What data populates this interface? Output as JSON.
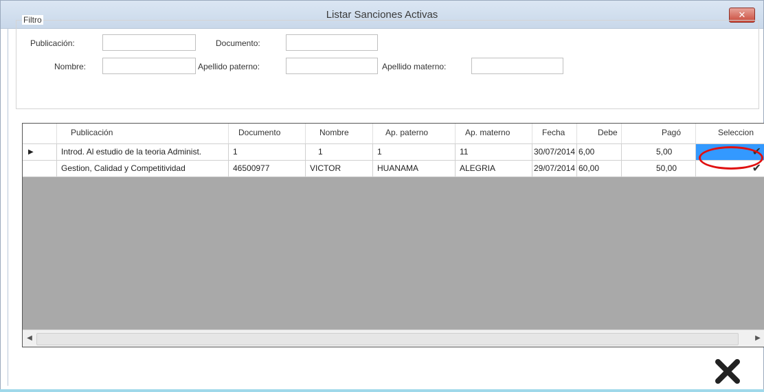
{
  "window": {
    "title": "Listar Sanciones Activas",
    "close_label": "✕"
  },
  "filter": {
    "legend": "Filtro",
    "publicacion_label": "Publicación:",
    "documento_label": "Documento:",
    "nombre_label": "Nombre:",
    "apellido_paterno_label": "Apellido paterno:",
    "apellido_materno_label": "Apellido materno:",
    "publicacion_value": "",
    "documento_value": "",
    "nombre_value": "",
    "apellido_paterno_value": "",
    "apellido_materno_value": ""
  },
  "grid": {
    "columns": [
      "Publicación",
      "Documento",
      "Nombre",
      "Ap. paterno",
      "Ap. materno",
      "Fecha",
      "Debe",
      "Pagó",
      "Seleccion"
    ],
    "rows": [
      {
        "marker": "▶",
        "publicacion": "Introd. Al estudio de la teoria Administ.",
        "documento": "1",
        "nombre": "1",
        "ap_paterno": "1",
        "ap_materno": "11",
        "fecha": "30/07/2014",
        "debe": "6,00",
        "pago": "5,00",
        "check": "✔"
      },
      {
        "marker": "",
        "publicacion": "Gestion, Calidad y Competitividad",
        "documento": "46500977",
        "nombre": "VICTOR",
        "ap_paterno": "HUANAMA",
        "ap_materno": "ALEGRIA",
        "fecha": "29/07/2014",
        "debe": "60,00",
        "pago": "50,00",
        "check": "✔"
      }
    ],
    "scroll_left": "◀",
    "scroll_right": "▶"
  },
  "actions": {
    "exit_icon": "close-x"
  }
}
